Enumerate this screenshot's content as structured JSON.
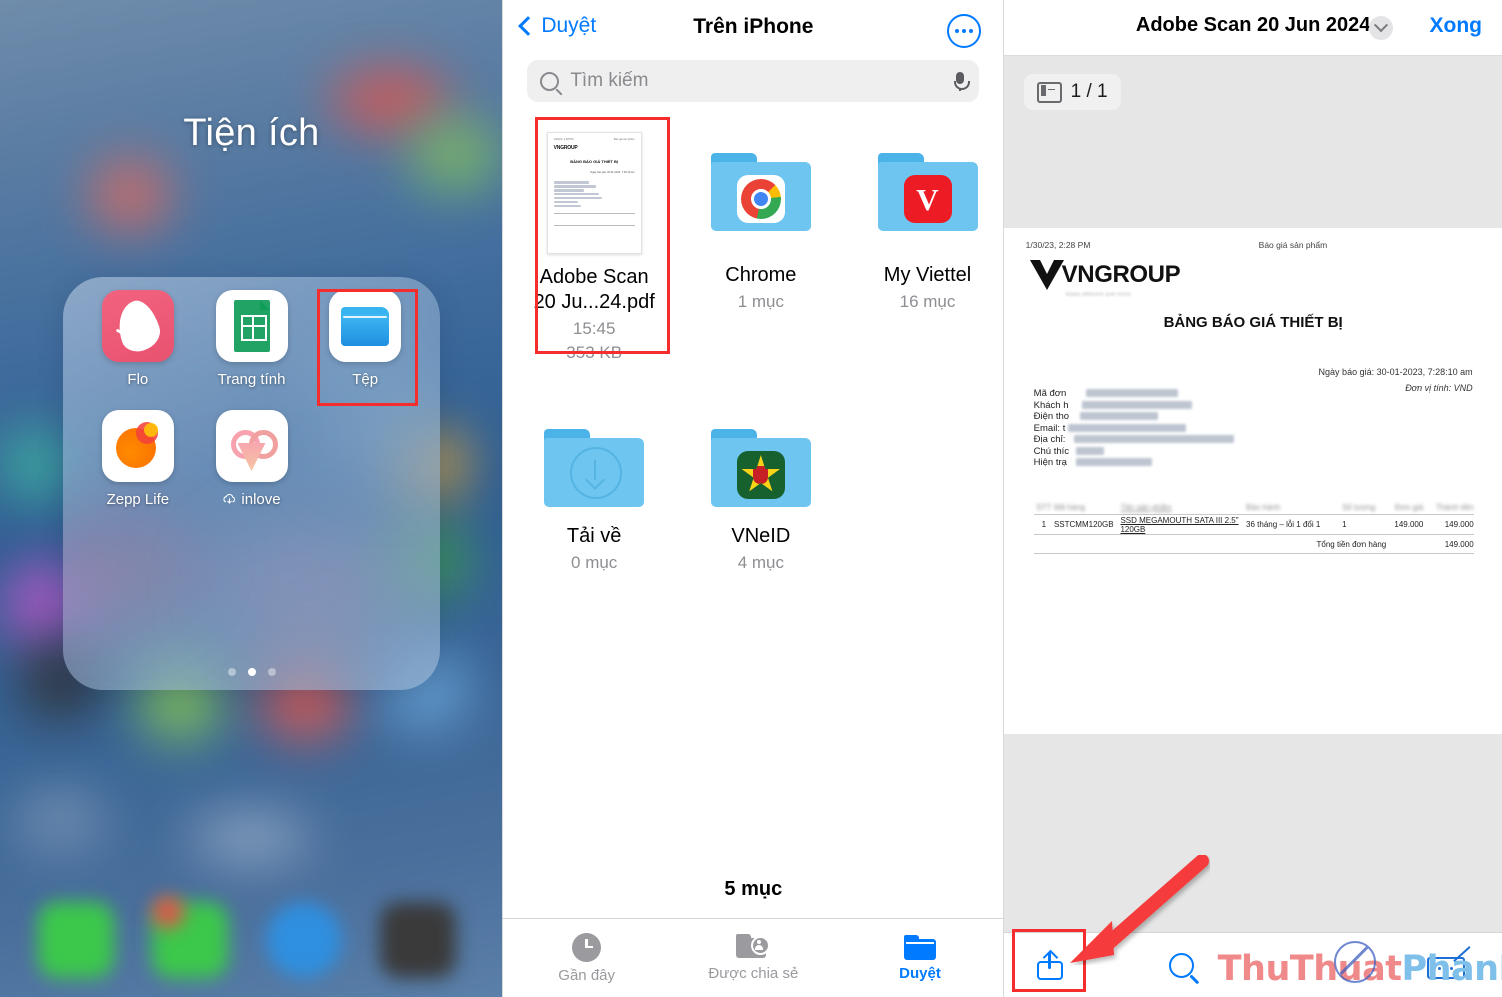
{
  "home": {
    "folder_title": "Tiện ích",
    "apps": [
      {
        "name": "Flo",
        "icon": "flo-app-icon"
      },
      {
        "name": "Trang tính",
        "icon": "google-sheets-app-icon"
      },
      {
        "name": "Tệp",
        "icon": "files-app-icon",
        "highlighted": true
      },
      {
        "name": "Zepp Life",
        "icon": "zepp-life-app-icon"
      },
      {
        "name": "inlove",
        "icon": "inlove-app-icon",
        "downloading": true
      }
    ],
    "page_dots": 3,
    "active_dot": 2
  },
  "files": {
    "nav": {
      "back_label": "Duyệt",
      "title": "Trên iPhone",
      "more_icon": "ellipsis-circle-icon"
    },
    "search": {
      "placeholder": "Tìm kiếm",
      "search_icon": "search-icon",
      "mic_icon": "microphone-icon"
    },
    "items": [
      {
        "name": "Adobe Scan\n20 Ju...24.pdf",
        "name_line1": "Adobe Scan",
        "name_line2": "20 Ju...24.pdf",
        "time": "15:45",
        "size": "353 KB",
        "kind": "pdf",
        "highlighted": true
      },
      {
        "name": "Chrome",
        "meta": "1 mục",
        "kind": "folder",
        "inner_icon": "chrome-icon"
      },
      {
        "name": "My Viettel",
        "meta": "16 mục",
        "kind": "folder",
        "inner_icon": "viettel-icon"
      },
      {
        "name": "Tải về",
        "meta": "0 mục",
        "kind": "folder",
        "inner_icon": "download-icon"
      },
      {
        "name": "VNeID",
        "meta": "4 mục",
        "kind": "folder",
        "inner_icon": "vneid-icon"
      }
    ],
    "item_count": "5 mục",
    "tabs": [
      {
        "label": "Gần đây",
        "icon": "clock-icon",
        "active": false
      },
      {
        "label": "Được chia sẻ",
        "icon": "shared-folder-icon",
        "active": false
      },
      {
        "label": "Duyệt",
        "icon": "folder-icon",
        "active": true
      }
    ]
  },
  "preview": {
    "title": "Adobe Scan 20 Jun 2024",
    "chevron_icon": "chevron-down-icon",
    "done_label": "Xong",
    "page_indicator": "1 / 1",
    "page_icon": "thumbnail-sidebar-icon",
    "toolbar": {
      "share_icon": "share-icon",
      "search_icon": "search-icon",
      "markup_icon": "markup-pen-icon"
    },
    "document": {
      "header_left": "1/30/23, 2:28 PM",
      "header_right": "Báo giá sản phẩm",
      "logo_text": "VNGROUP",
      "title": "BẢNG BÁO GIÁ THIẾT BỊ",
      "quote_date": "Ngày báo giá: 30-01-2023, 7:28:10 am",
      "currency": "Đơn vị tính: VND",
      "fields": [
        {
          "label": "Mã đơn",
          "redacted": true
        },
        {
          "label": "Khách h",
          "redacted": true
        },
        {
          "label": "Điện tho",
          "redacted": true
        },
        {
          "label": "Email: t",
          "redacted": true
        },
        {
          "label": "Địa chỉ:",
          "redacted": true
        },
        {
          "label": "Chú thíc",
          "redacted": true
        },
        {
          "label": "Hiện trạ",
          "redacted": true
        }
      ],
      "table": {
        "row": {
          "index": "1",
          "code": "SSTCMM120GB",
          "description": "SSD MEGAMOUTH SATA III 2.5\" 120GB",
          "warranty": "36 tháng – lỗi 1 đổi 1",
          "qty": "1",
          "unit_price": "149.000",
          "amount": "149.000"
        },
        "total_label": "Tổng tiền đơn hàng",
        "total_value": "149.000"
      }
    }
  },
  "watermark": {
    "part1": "ThuThuat",
    "part2": "PhanMem.vn"
  },
  "annotations": {
    "highlight_color": "#f52d2d",
    "arrow_color": "#f53b3b",
    "accent_color": "#007aff"
  }
}
